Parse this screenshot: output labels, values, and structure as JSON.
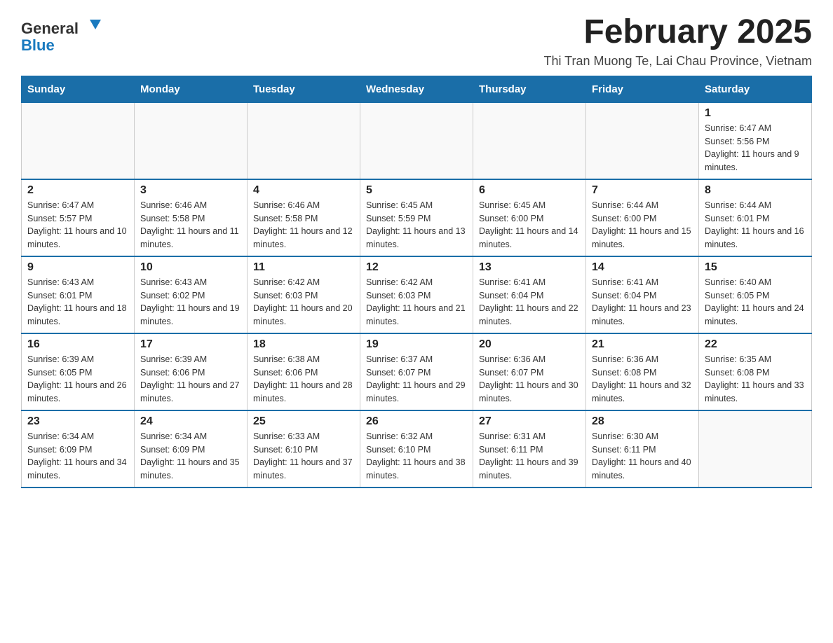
{
  "header": {
    "logo_general": "General",
    "logo_blue": "Blue",
    "main_title": "February 2025",
    "subtitle": "Thi Tran Muong Te, Lai Chau Province, Vietnam"
  },
  "calendar": {
    "days_of_week": [
      "Sunday",
      "Monday",
      "Tuesday",
      "Wednesday",
      "Thursday",
      "Friday",
      "Saturday"
    ],
    "weeks": [
      [
        {
          "day": "",
          "info": ""
        },
        {
          "day": "",
          "info": ""
        },
        {
          "day": "",
          "info": ""
        },
        {
          "day": "",
          "info": ""
        },
        {
          "day": "",
          "info": ""
        },
        {
          "day": "",
          "info": ""
        },
        {
          "day": "1",
          "info": "Sunrise: 6:47 AM\nSunset: 5:56 PM\nDaylight: 11 hours and 9 minutes."
        }
      ],
      [
        {
          "day": "2",
          "info": "Sunrise: 6:47 AM\nSunset: 5:57 PM\nDaylight: 11 hours and 10 minutes."
        },
        {
          "day": "3",
          "info": "Sunrise: 6:46 AM\nSunset: 5:58 PM\nDaylight: 11 hours and 11 minutes."
        },
        {
          "day": "4",
          "info": "Sunrise: 6:46 AM\nSunset: 5:58 PM\nDaylight: 11 hours and 12 minutes."
        },
        {
          "day": "5",
          "info": "Sunrise: 6:45 AM\nSunset: 5:59 PM\nDaylight: 11 hours and 13 minutes."
        },
        {
          "day": "6",
          "info": "Sunrise: 6:45 AM\nSunset: 6:00 PM\nDaylight: 11 hours and 14 minutes."
        },
        {
          "day": "7",
          "info": "Sunrise: 6:44 AM\nSunset: 6:00 PM\nDaylight: 11 hours and 15 minutes."
        },
        {
          "day": "8",
          "info": "Sunrise: 6:44 AM\nSunset: 6:01 PM\nDaylight: 11 hours and 16 minutes."
        }
      ],
      [
        {
          "day": "9",
          "info": "Sunrise: 6:43 AM\nSunset: 6:01 PM\nDaylight: 11 hours and 18 minutes."
        },
        {
          "day": "10",
          "info": "Sunrise: 6:43 AM\nSunset: 6:02 PM\nDaylight: 11 hours and 19 minutes."
        },
        {
          "day": "11",
          "info": "Sunrise: 6:42 AM\nSunset: 6:03 PM\nDaylight: 11 hours and 20 minutes."
        },
        {
          "day": "12",
          "info": "Sunrise: 6:42 AM\nSunset: 6:03 PM\nDaylight: 11 hours and 21 minutes."
        },
        {
          "day": "13",
          "info": "Sunrise: 6:41 AM\nSunset: 6:04 PM\nDaylight: 11 hours and 22 minutes."
        },
        {
          "day": "14",
          "info": "Sunrise: 6:41 AM\nSunset: 6:04 PM\nDaylight: 11 hours and 23 minutes."
        },
        {
          "day": "15",
          "info": "Sunrise: 6:40 AM\nSunset: 6:05 PM\nDaylight: 11 hours and 24 minutes."
        }
      ],
      [
        {
          "day": "16",
          "info": "Sunrise: 6:39 AM\nSunset: 6:05 PM\nDaylight: 11 hours and 26 minutes."
        },
        {
          "day": "17",
          "info": "Sunrise: 6:39 AM\nSunset: 6:06 PM\nDaylight: 11 hours and 27 minutes."
        },
        {
          "day": "18",
          "info": "Sunrise: 6:38 AM\nSunset: 6:06 PM\nDaylight: 11 hours and 28 minutes."
        },
        {
          "day": "19",
          "info": "Sunrise: 6:37 AM\nSunset: 6:07 PM\nDaylight: 11 hours and 29 minutes."
        },
        {
          "day": "20",
          "info": "Sunrise: 6:36 AM\nSunset: 6:07 PM\nDaylight: 11 hours and 30 minutes."
        },
        {
          "day": "21",
          "info": "Sunrise: 6:36 AM\nSunset: 6:08 PM\nDaylight: 11 hours and 32 minutes."
        },
        {
          "day": "22",
          "info": "Sunrise: 6:35 AM\nSunset: 6:08 PM\nDaylight: 11 hours and 33 minutes."
        }
      ],
      [
        {
          "day": "23",
          "info": "Sunrise: 6:34 AM\nSunset: 6:09 PM\nDaylight: 11 hours and 34 minutes."
        },
        {
          "day": "24",
          "info": "Sunrise: 6:34 AM\nSunset: 6:09 PM\nDaylight: 11 hours and 35 minutes."
        },
        {
          "day": "25",
          "info": "Sunrise: 6:33 AM\nSunset: 6:10 PM\nDaylight: 11 hours and 37 minutes."
        },
        {
          "day": "26",
          "info": "Sunrise: 6:32 AM\nSunset: 6:10 PM\nDaylight: 11 hours and 38 minutes."
        },
        {
          "day": "27",
          "info": "Sunrise: 6:31 AM\nSunset: 6:11 PM\nDaylight: 11 hours and 39 minutes."
        },
        {
          "day": "28",
          "info": "Sunrise: 6:30 AM\nSunset: 6:11 PM\nDaylight: 11 hours and 40 minutes."
        },
        {
          "day": "",
          "info": ""
        }
      ]
    ]
  }
}
